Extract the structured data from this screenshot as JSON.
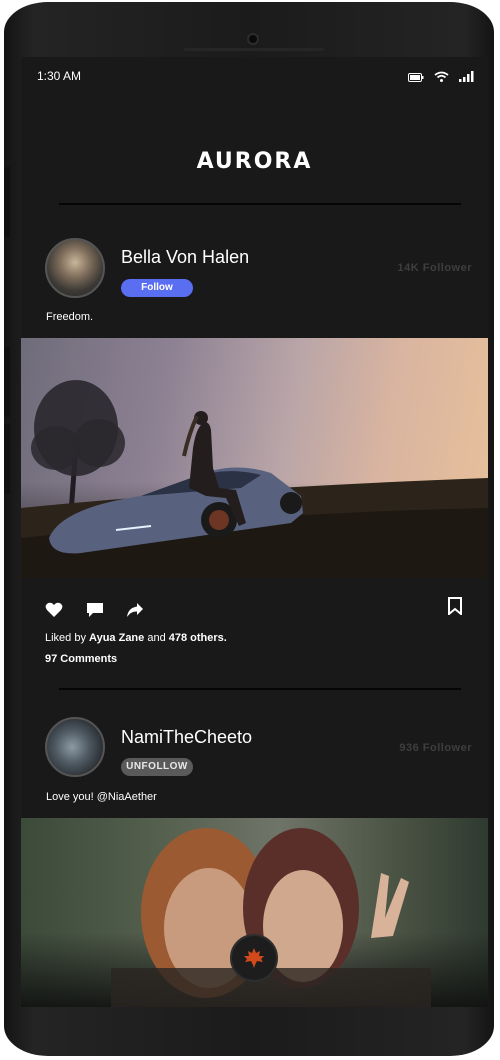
{
  "status_bar": {
    "time": "1:30 AM",
    "icons": [
      "battery-icon",
      "wifi-icon",
      "signal-icon"
    ]
  },
  "app": {
    "logo_text": "AURORA"
  },
  "posts": [
    {
      "author": "Bella Von Halen",
      "follow_label": "Follow",
      "followers": "14K Follower",
      "caption": "Freedom.",
      "actions": [
        "heart-icon",
        "comment-icon",
        "share-icon",
        "bookmark-icon"
      ],
      "likes_prefix": "Liked by",
      "liked_by": "Ayua Zane",
      "likes_and": "and",
      "likes_others": "478 others.",
      "comments": "97 Comments"
    },
    {
      "author": "NamiTheCheeto",
      "follow_label": "UNFOLLOW",
      "followers": "936 Follower",
      "caption": "Love you! @NiaAether"
    }
  ],
  "fab_icon": "maple-leaf-icon",
  "colors": {
    "background": "#191919",
    "accent": "#5a6ef2",
    "fab_icon": "#d24a1c"
  }
}
